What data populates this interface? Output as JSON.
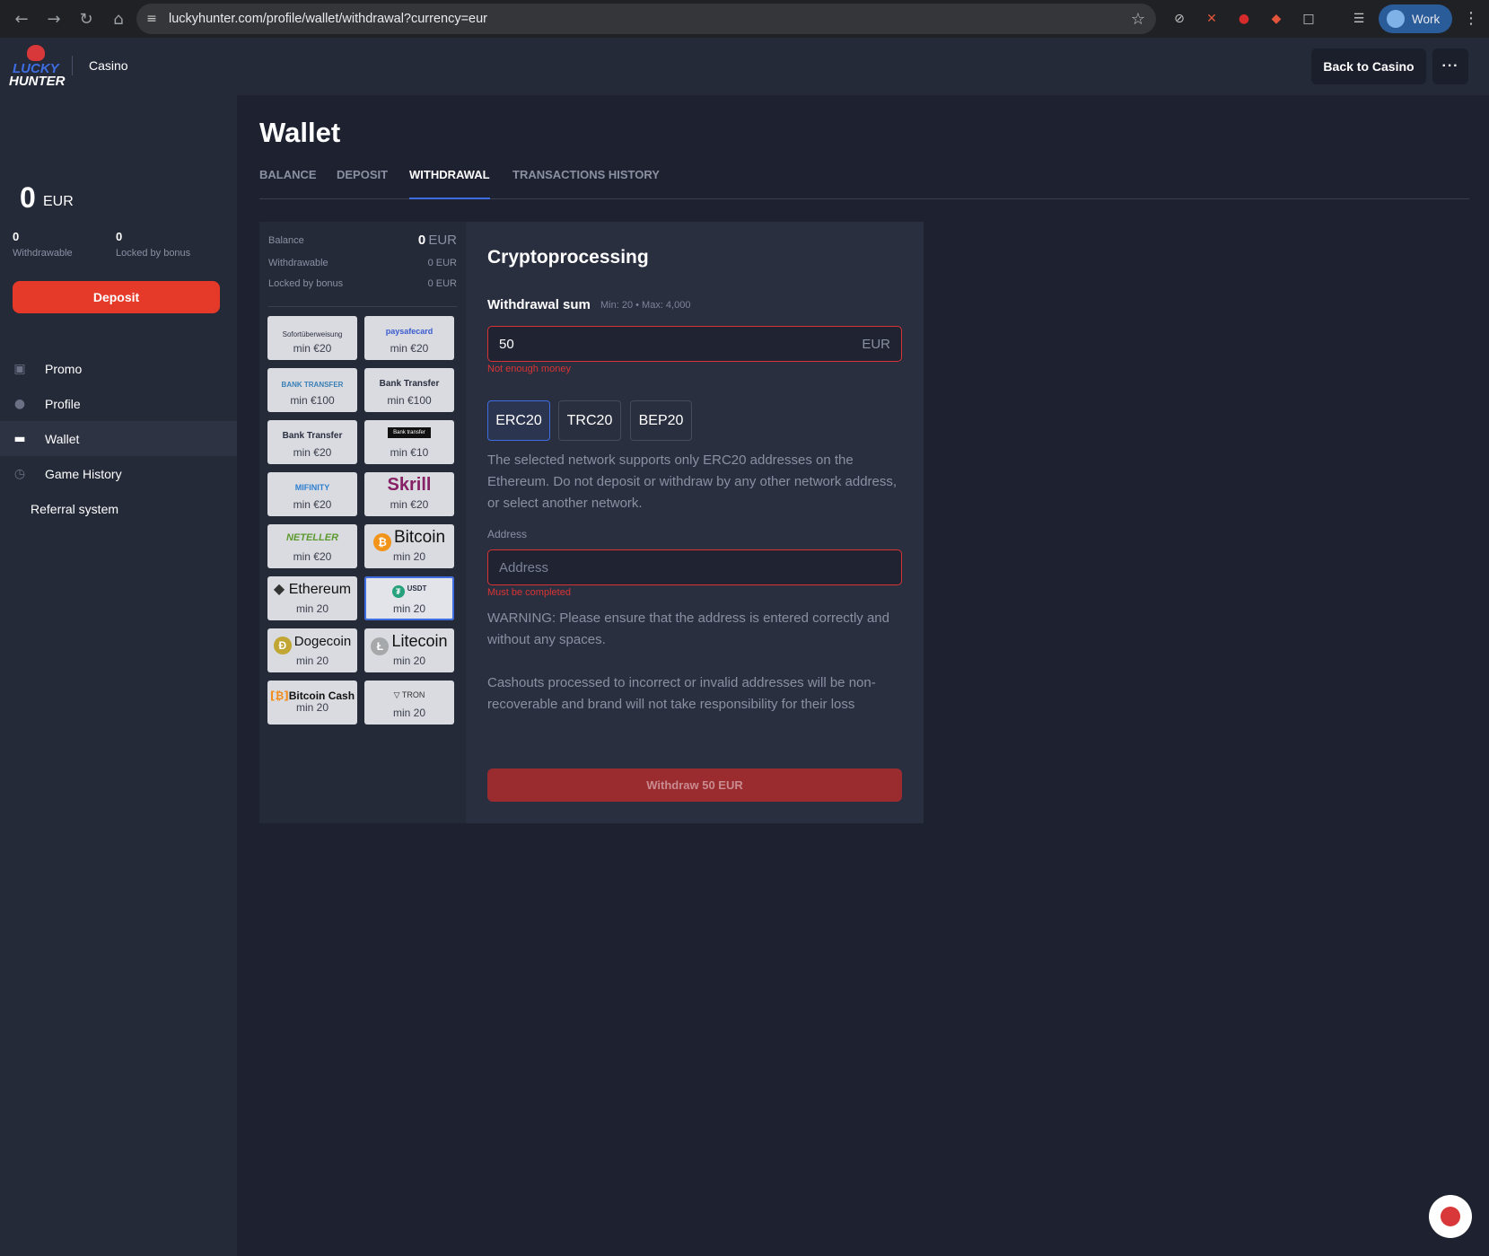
{
  "browser": {
    "url": "luckyhunter.com/profile/wallet/withdrawal?currency=eur",
    "profile_label": "Work"
  },
  "header": {
    "logo_line1": "LUCKY",
    "logo_line2": "HUNTER",
    "casino_link": "Casino",
    "back_button": "Back to Casino",
    "more_button": "···"
  },
  "sidebar": {
    "balance_amount": "0",
    "balance_currency": "EUR",
    "withdrawable_value": "0",
    "withdrawable_label": "Withdrawable",
    "locked_value": "0",
    "locked_label": "Locked by bonus",
    "deposit_button": "Deposit",
    "menu": [
      {
        "label": "Promo",
        "icon": "gift-icon"
      },
      {
        "label": "Profile",
        "icon": "user-icon"
      },
      {
        "label": "Wallet",
        "icon": "wallet-icon"
      },
      {
        "label": "Game History",
        "icon": "clock-icon"
      },
      {
        "label": "Referral system",
        "icon": ""
      }
    ]
  },
  "main": {
    "title": "Wallet",
    "tabs": [
      "BALANCE",
      "DEPOSIT",
      "WITHDRAWAL",
      "TRANSACTIONS HISTORY"
    ],
    "active_tab": "WITHDRAWAL"
  },
  "summary": {
    "balance_label": "Balance",
    "balance_value": "0",
    "balance_currency": "EUR",
    "withdrawable_label": "Withdrawable",
    "withdrawable_value": "0 EUR",
    "locked_label": "Locked by bonus",
    "locked_value": "0 EUR"
  },
  "methods": [
    {
      "name": "Sofortüberweisung",
      "min": "min €20"
    },
    {
      "name": "paysafecard",
      "min": "min €20"
    },
    {
      "name": "BANK TRANSFER",
      "min": "min €100"
    },
    {
      "name": "Bank Transfer",
      "min": "min €100"
    },
    {
      "name": "Bank Transfer",
      "min": "min €20"
    },
    {
      "name": "Bank transfer",
      "min": "min €10"
    },
    {
      "name": "MIFINITY",
      "min": "min €20"
    },
    {
      "name": "Skrill",
      "min": "min €20"
    },
    {
      "name": "NETELLER",
      "min": "min €20"
    },
    {
      "name": "Bitcoin",
      "min": "min 20"
    },
    {
      "name": "Ethereum",
      "min": "min 20"
    },
    {
      "name": "USDT",
      "min": "min 20"
    },
    {
      "name": "Dogecoin",
      "min": "min 20"
    },
    {
      "name": "Litecoin",
      "min": "min 20"
    },
    {
      "name": "Bitcoin Cash",
      "min": "min 20"
    },
    {
      "name": "TRON",
      "min": "min 20"
    }
  ],
  "form": {
    "title": "Cryptoprocessing",
    "sum_label": "Withdrawal sum",
    "sum_hint": "Min: 20 • Max: 4,000",
    "amount_value": "50",
    "amount_currency": "EUR",
    "amount_error": "Not enough money",
    "networks": [
      "ERC20",
      "TRC20",
      "BEP20"
    ],
    "active_network": "ERC20",
    "network_note": "The selected network supports only ERC20 addresses on the Ethereum. Do not deposit or withdraw by any other network address, or select another network.",
    "address_label": "Address",
    "address_placeholder": "Address",
    "address_error": "Must be completed",
    "warning": "WARNING: Please ensure that the address is entered correctly and without any spaces.",
    "cashout_note": "Cashouts processed to incorrect or invalid addresses will be non-recoverable and brand will not take responsibility for their loss",
    "withdraw_button": "Withdraw 50 EUR"
  },
  "colors": {
    "accent": "#3d6de0",
    "deposit": "#e53a2a",
    "error": "#d83434",
    "background": "#1e2230"
  }
}
